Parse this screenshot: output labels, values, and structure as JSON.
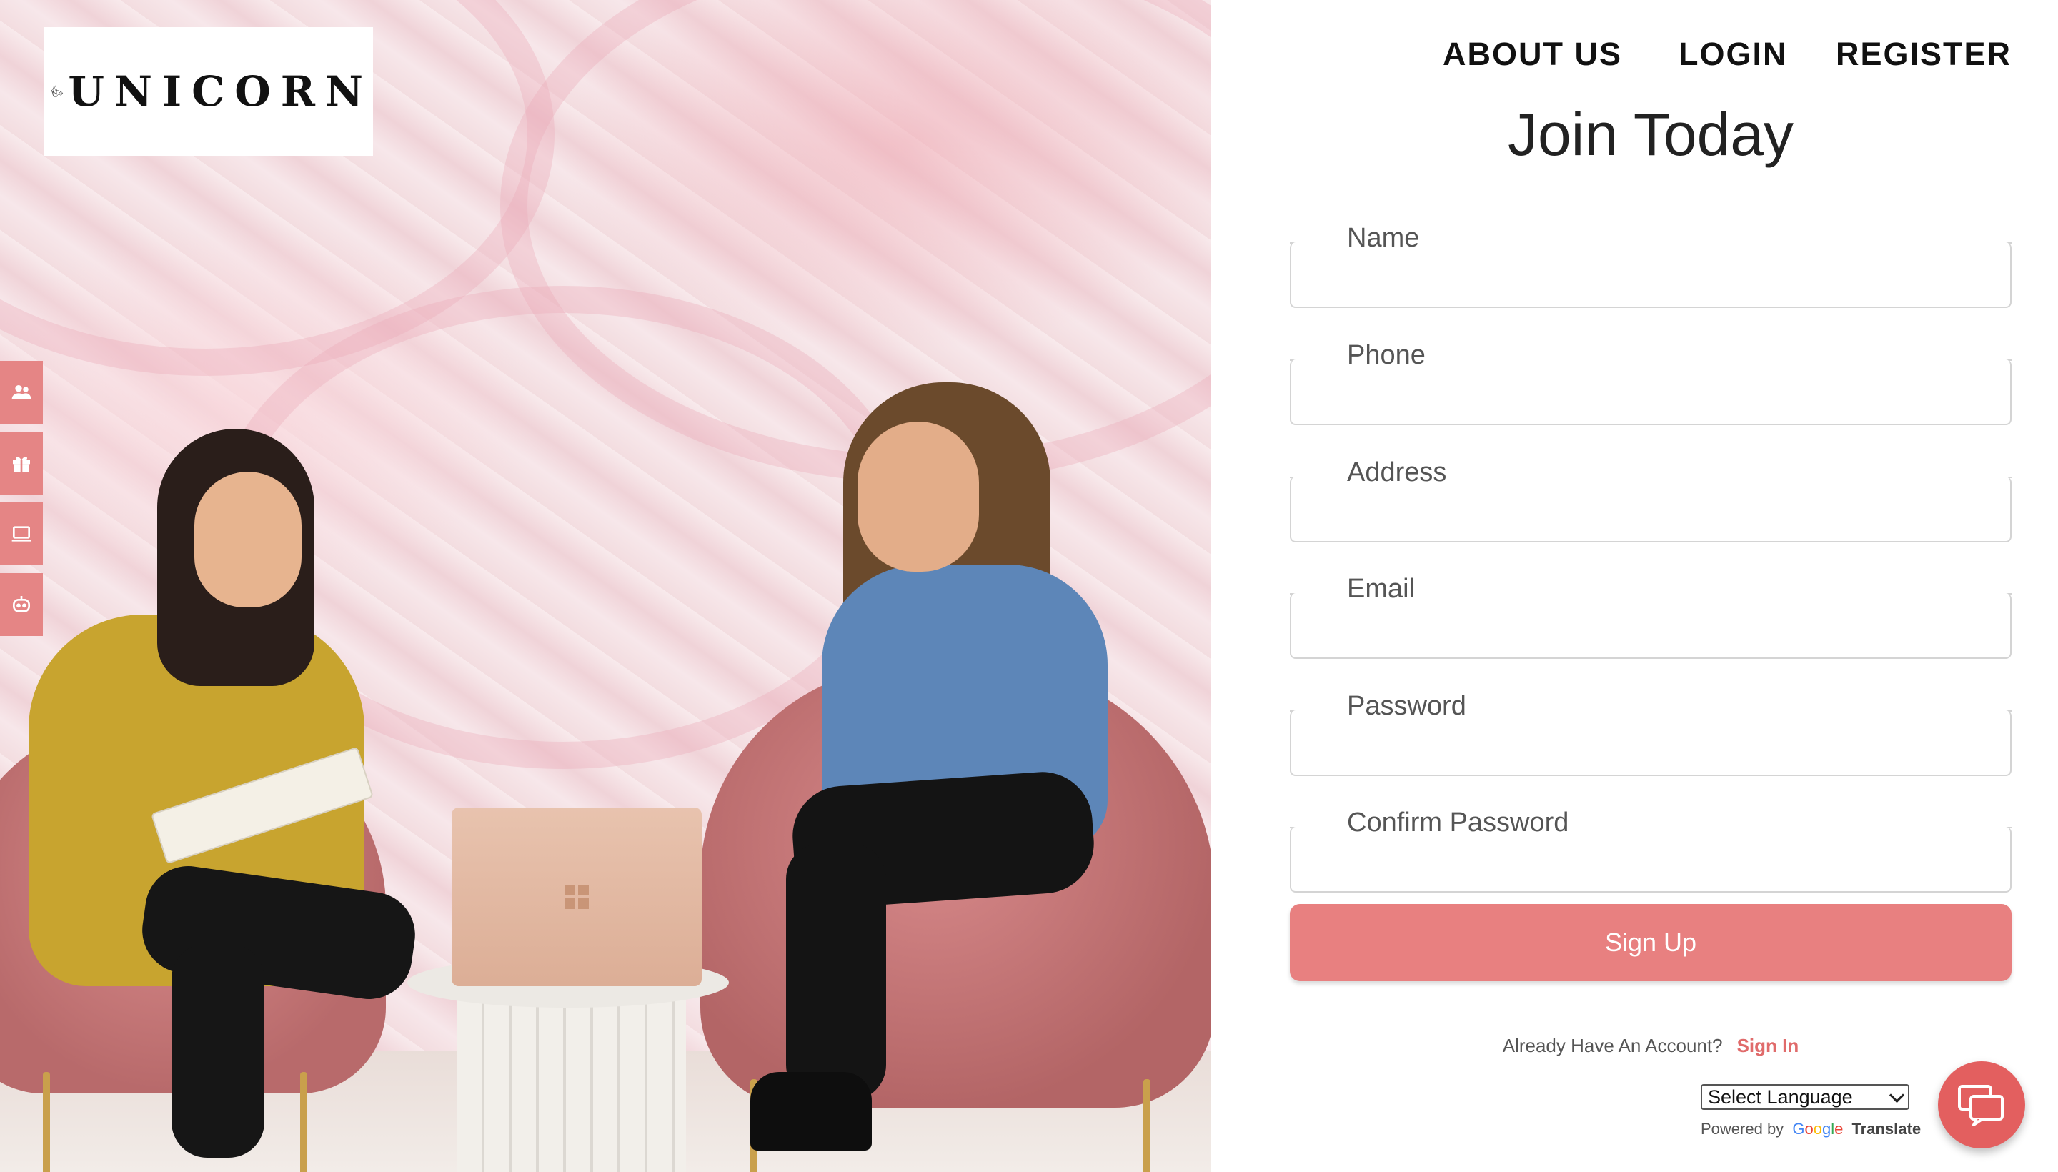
{
  "logo": {
    "text": "UNICORN",
    "icon": "geometric-unicorn-head"
  },
  "nav": {
    "about": "ABOUT US",
    "login": "LOGIN",
    "register": "REGISTER"
  },
  "side_icons": [
    "users-icon",
    "gift-icon",
    "laptop-icon",
    "robot-icon"
  ],
  "form": {
    "title": "Join Today",
    "fields": [
      {
        "label": "Name",
        "value": ""
      },
      {
        "label": "Phone",
        "value": ""
      },
      {
        "label": "Address",
        "value": ""
      },
      {
        "label": "Email",
        "value": ""
      },
      {
        "label": "Password",
        "value": ""
      },
      {
        "label": "Confirm Password",
        "value": ""
      }
    ],
    "submit": "Sign Up",
    "already_text": "Already Have An Account?",
    "signin_link": "Sign In"
  },
  "translate": {
    "select_label": "Select Language",
    "powered_by": "Powered by",
    "google": [
      "G",
      "o",
      "o",
      "g",
      "l",
      "e"
    ],
    "translate_word": "Translate"
  },
  "colors": {
    "accent": "#e88080",
    "side_icon_bg": "#e58585",
    "chat_fab": "#e35f5f",
    "signin": "#e06b6b"
  },
  "chat": {
    "icon": "chat-bubbles-icon"
  }
}
